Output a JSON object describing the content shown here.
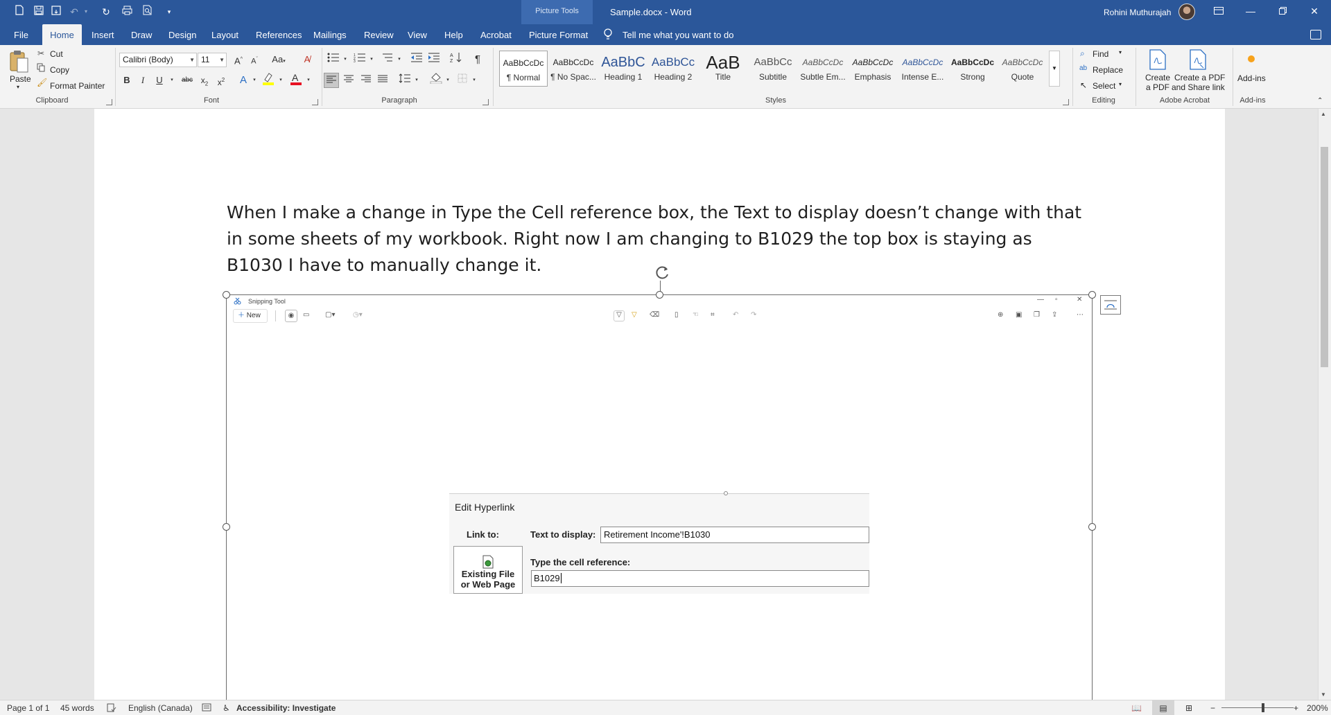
{
  "app": {
    "document_title": "Sample.docx  -  Word",
    "contextual_group": "Picture Tools",
    "user_name": "Rohini Muthurajah"
  },
  "tabs": [
    {
      "label": "File"
    },
    {
      "label": "Home"
    },
    {
      "label": "Insert"
    },
    {
      "label": "Draw"
    },
    {
      "label": "Design"
    },
    {
      "label": "Layout"
    },
    {
      "label": "References"
    },
    {
      "label": "Mailings"
    },
    {
      "label": "Review"
    },
    {
      "label": "View"
    },
    {
      "label": "Help"
    },
    {
      "label": "Acrobat"
    },
    {
      "label": "Picture Format"
    }
  ],
  "tell_me": "Tell me what you want to do",
  "clipboard": {
    "paste": "Paste",
    "cut": "Cut",
    "copy": "Copy",
    "format_painter": "Format Painter",
    "label": "Clipboard"
  },
  "font": {
    "family": "Calibri (Body)",
    "size": "11",
    "label": "Font",
    "change_case": "Aa"
  },
  "paragraph": {
    "label": "Paragraph"
  },
  "styles": {
    "label": "Styles",
    "items": [
      {
        "preview": "AaBbCcDc",
        "name": "¶ Normal"
      },
      {
        "preview": "AaBbCcDc",
        "name": "¶ No Spac..."
      },
      {
        "preview": "AaBbC",
        "name": "Heading 1"
      },
      {
        "preview": "AaBbCc",
        "name": "Heading 2"
      },
      {
        "preview": "AaB",
        "name": "Title"
      },
      {
        "preview": "AaBbCc",
        "name": "Subtitle"
      },
      {
        "preview": "AaBbCcDc",
        "name": "Subtle Em..."
      },
      {
        "preview": "AaBbCcDc",
        "name": "Emphasis"
      },
      {
        "preview": "AaBbCcDc",
        "name": "Intense E..."
      },
      {
        "preview": "AaBbCcDc",
        "name": "Strong"
      },
      {
        "preview": "AaBbCcDc",
        "name": "Quote"
      }
    ]
  },
  "editing": {
    "find": "Find",
    "replace": "Replace",
    "select": "Select",
    "label": "Editing"
  },
  "acrobat": {
    "create_pdf_1": "Create",
    "create_pdf_2": "a PDF",
    "share_1": "Create a PDF",
    "share_2": "and Share link",
    "label": "Adobe Acrobat"
  },
  "addins": {
    "button": "Add-ins",
    "label": "Add-ins"
  },
  "document": {
    "body_text": "When I make a change in Type the Cell reference box, the Text to display doesn’t change with that in some sheets of my workbook. Right now I am changing to B1029 the top box is staying as B1030 I have to manually change it."
  },
  "snipping_tool": {
    "title": "Snipping Tool",
    "new_button": "New"
  },
  "edit_hyperlink": {
    "title": "Edit Hyperlink",
    "link_to_label": "Link to:",
    "text_to_display_label": "Text to display:",
    "text_to_display_value": "Retirement Income'!B1030",
    "cell_ref_label": "Type the cell reference:",
    "cell_ref_value": "B1029",
    "existing_file_1": "Existing File",
    "existing_file_2": "or Web Page"
  },
  "status": {
    "page": "Page 1 of 1",
    "words": "45 words",
    "language": "English (Canada)",
    "accessibility": "Accessibility: Investigate",
    "zoom": "200%"
  },
  "colors": {
    "accent": "#2b579a",
    "ribbon": "#f3f3f3",
    "font_color_bar": "#e81123",
    "highlight_bar": "#ffff00",
    "addin_dot": "#f7a21b"
  }
}
